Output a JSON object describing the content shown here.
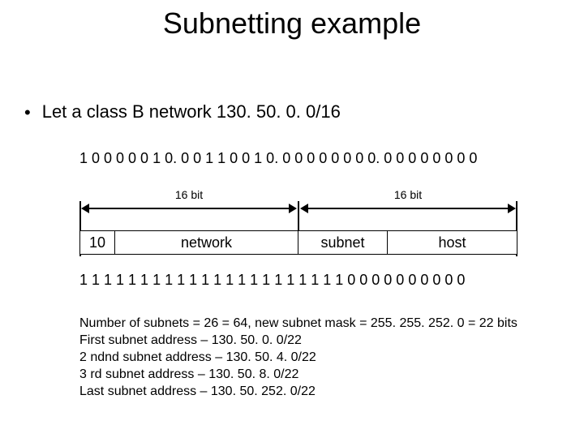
{
  "title": "Subnetting example",
  "bullet_text": "Let a class B network 130. 50. 0. 0/16",
  "binary_top": "1 0 0 0 0 0 1 0. 0 0 1 1 0 0 1 0. 0 0 0 0 0 0 0 0. 0 0 0 0 0 0 0 0",
  "dim_left_label": "16 bit",
  "dim_right_label": "16 bit",
  "box_class": "10",
  "box_network": "network",
  "box_subnet": "subnet",
  "box_host": "host",
  "binary_bottom": "1 1 1 1 1 1 1 1 1 1 1 1 1 1 1 1 1 1 1 1 1 1 0 0 0 0 0 0 0 0 0 0",
  "notes": {
    "l1": "Number of subnets = 26 = 64, new subnet mask = 255. 255. 252. 0 = 22 bits",
    "l2": "First subnet address – 130. 50. 0. 0/22",
    "l3": "2 ndnd subnet address – 130. 50. 4. 0/22",
    "l4": "3 rd subnet address – 130. 50. 8. 0/22",
    "l5": "Last subnet address – 130. 50. 252. 0/22"
  }
}
